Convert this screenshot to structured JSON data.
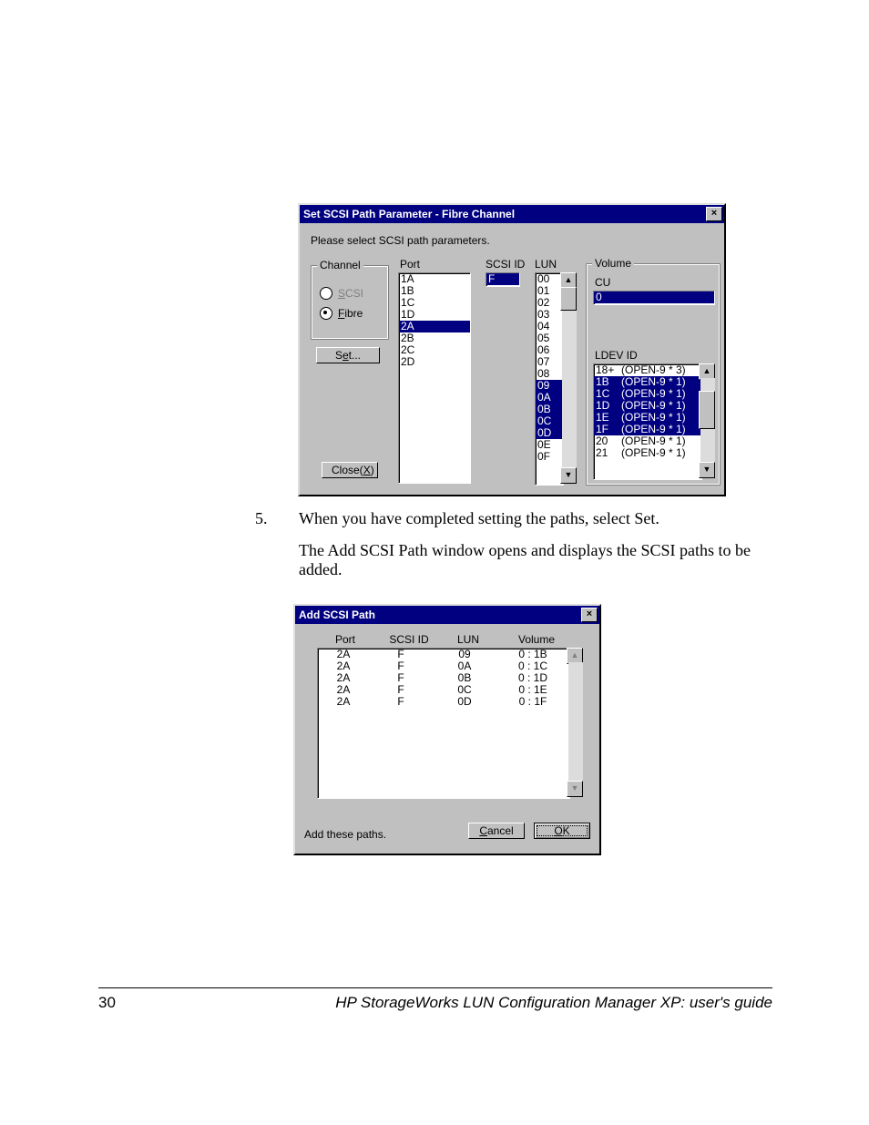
{
  "page": {
    "number": "30",
    "footer_title": "HP StorageWorks LUN Configuration Manager XP: user's guide"
  },
  "step": {
    "number": "5.",
    "text": "When you have completed setting the paths, select Set."
  },
  "para2": "The Add SCSI Path window opens and displays the SCSI paths to be added.",
  "dlg1": {
    "title": "Set SCSI Path Parameter - Fibre Channel",
    "instruction": "Please select SCSI path parameters.",
    "channel_legend": "Channel",
    "scsi_label_pre": "S",
    "scsi_label_post": "CSI",
    "fibre_label_pre": "F",
    "fibre_label_post": "ibre",
    "set_btn_pre": "S",
    "set_btn_u": "e",
    "set_btn_post": "t...",
    "close_btn_pre": "Close(",
    "close_btn_u": "X",
    "close_btn_post": ")",
    "port_label": "Port",
    "ports": [
      "1A",
      "1B",
      "1C",
      "1D",
      "2A",
      "2B",
      "2C",
      "2D"
    ],
    "port_selected_index": 4,
    "scsiid_label": "SCSI ID",
    "scsiid_value": "F",
    "lun_label": "LUN",
    "luns": [
      "00",
      "01",
      "02",
      "03",
      "04",
      "05",
      "06",
      "07",
      "08",
      "09",
      "0A",
      "0B",
      "0C",
      "0D",
      "0E",
      "0F"
    ],
    "lun_selected": [
      9,
      10,
      11,
      12,
      13
    ],
    "volume_legend": "Volume",
    "cu_label": "CU",
    "cu_value": "0",
    "ldev_label": "LDEV ID",
    "ldevs": [
      {
        "id": "18+",
        "t": "(OPEN-9 * 3)"
      },
      {
        "id": "1B",
        "t": "(OPEN-9 * 1)"
      },
      {
        "id": "1C",
        "t": "(OPEN-9 * 1)"
      },
      {
        "id": "1D",
        "t": "(OPEN-9 * 1)"
      },
      {
        "id": "1E",
        "t": "(OPEN-9 * 1)"
      },
      {
        "id": "1F",
        "t": "(OPEN-9 * 1)"
      },
      {
        "id": "20",
        "t": "(OPEN-9 * 1)"
      },
      {
        "id": "21",
        "t": "(OPEN-9 * 1)"
      }
    ],
    "ldev_selected": [
      1,
      2,
      3,
      4,
      5
    ]
  },
  "dlg2": {
    "title": "Add SCSI Path",
    "col_port": "Port",
    "col_scsiid": "SCSI ID",
    "col_lun": "LUN",
    "col_volume": "Volume",
    "rows": [
      {
        "port": "2A",
        "scsiid": "F",
        "lun": "09",
        "volume": "0 : 1B"
      },
      {
        "port": "2A",
        "scsiid": "F",
        "lun": "0A",
        "volume": "0 : 1C"
      },
      {
        "port": "2A",
        "scsiid": "F",
        "lun": "0B",
        "volume": "0 : 1D"
      },
      {
        "port": "2A",
        "scsiid": "F",
        "lun": "0C",
        "volume": "0 : 1E"
      },
      {
        "port": "2A",
        "scsiid": "F",
        "lun": "0D",
        "volume": "0 : 1F"
      }
    ],
    "add_label": "Add these paths.",
    "cancel_u": "C",
    "cancel_post": "ancel",
    "ok_u": "O",
    "ok_post": "K"
  },
  "close_glyph": "×",
  "arrow_up": "▲",
  "arrow_down": "▼"
}
